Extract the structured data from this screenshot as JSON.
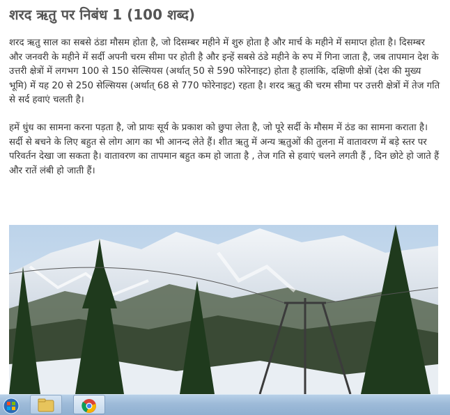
{
  "article": {
    "title": "शरद ऋतु पर निबंध 1 (100 शब्द)",
    "paragraph1": "शरद ऋतु साल का सबसे ठंडा मौसम होता है, जो दिसम्बर महीने में शुरु होता है और मार्च के महीने में समाप्त होता है। दिसम्बर और जनवरी के महीने में सर्दी अपनी चरम सीमा पर होती है और इन्हें सबसे ठंडे महीने के रुप में गिना जाता है, जब तापमान देश के उत्तरी क्षेत्रों में लगभग 100 से 150 सेल्सियस (अर्थात् 50 से 590 फोरेनाइट) होता है हालांकि, दक्षिणी क्षेत्रों (देश की मुख्य भूमि) में यह 20 से 250 सेल्सियस (अर्थात् 68 से 770 फोरेनाइट) रहता है। शरद ऋतु की चरम सीमा पर उत्तरी क्षेत्रों में तेज गति से सर्द हवाएं चलती है।",
    "paragraph2": "हमें धुंध का सामना करना पड़ता है, जो प्रायः सूर्य के प्रकाश को छुपा लेता है, जो पूरे सर्दी के मौसम में ठंड का सामना कराता है। सर्दी से बचने के लिए बहुत से लोग आग का भी आनन्द लेते हैं। शीत ऋतु में अन्य ऋतुओं की तुलना में वातावरण में बड़े स्तर पर परिवर्तन देखा जा सकता है। वातावरण का तापमान बहुत कम हो जाता है , तेज गति से हवाएं चलने लगती हैं , दिन छोटे हो जाते हैं और रातें लंबी हो जाती हैं।"
  },
  "image": {
    "subject": "snowy-mountain-landscape",
    "colors": {
      "sky": "#c9dced",
      "snow": "#eef3f8",
      "forest": "#2e3f2a",
      "pine": "#1f3a1d"
    }
  },
  "taskbar": {
    "icons": [
      "windows-start-icon",
      "file-explorer-icon",
      "chrome-icon"
    ]
  }
}
